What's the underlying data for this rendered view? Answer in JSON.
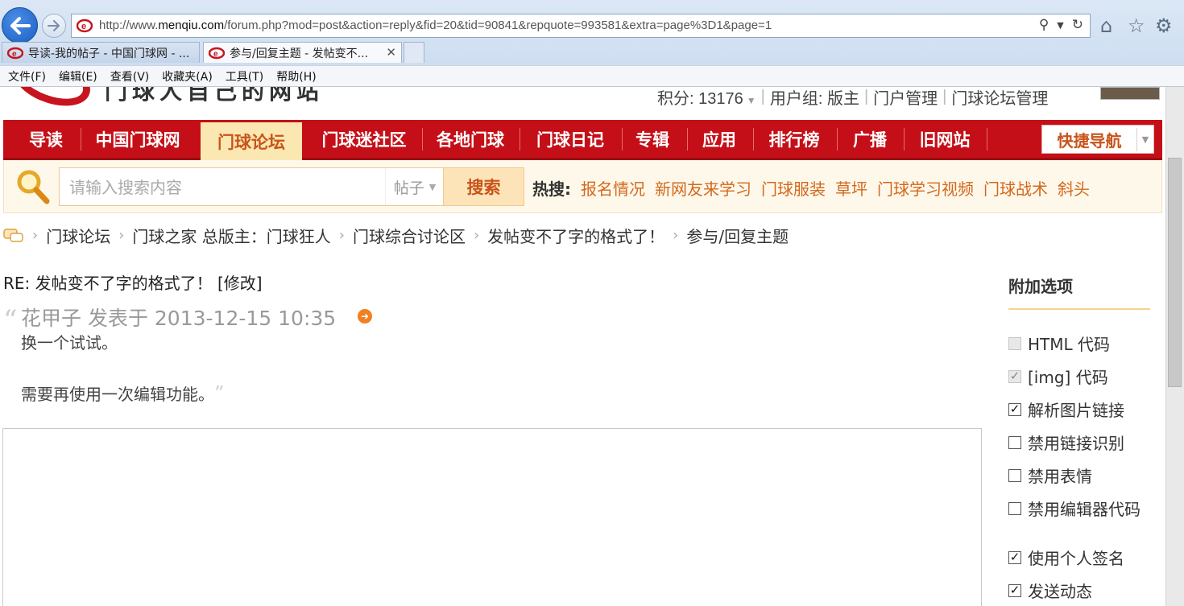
{
  "browser": {
    "url_prefix": "http://www.",
    "url_domain": "menqiu.com",
    "url_rest": "/forum.php?mod=post&action=reply&fid=20&tid=90841&repquote=993581&extra=page%3D1&page=1",
    "tabs": [
      {
        "label": "导读-我的帖子 - 中国门球网 - ...",
        "active": false
      },
      {
        "label": "参与/回复主题 - 发帖变不...",
        "active": true
      }
    ],
    "menu": [
      "文件(F)",
      "编辑(E)",
      "查看(V)",
      "收藏夹(A)",
      "工具(T)",
      "帮助(H)"
    ]
  },
  "header": {
    "logo_text": "门球人自己的网站",
    "points_label": "积分: 13176",
    "user_group": "用户组: 版主",
    "portal_admin": "门户管理",
    "forum_admin": "门球论坛管理"
  },
  "nav": {
    "items": [
      "导读",
      "中国门球网",
      "门球论坛",
      "门球迷社区",
      "各地门球",
      "门球日记",
      "专辑",
      "应用",
      "排行榜",
      "广播",
      "旧网站"
    ],
    "active_index": 2,
    "quick_nav": "快捷导航"
  },
  "search": {
    "placeholder": "请输入搜索内容",
    "type": "帖子",
    "button": "搜索",
    "hot_label": "热搜:",
    "hot_terms": [
      "报名情况",
      "新网友来学习",
      "门球服装",
      "草坪",
      "门球学习视频",
      "门球战术",
      "斜头"
    ]
  },
  "breadcrumb": [
    "门球论坛",
    "门球之家 总版主：门球狂人",
    "门球综合讨论区",
    "发帖变不了字的格式了！",
    "参与/回复主题"
  ],
  "post": {
    "title": "RE: 发帖变不了字的格式了！ [修改]",
    "quote_author": "花甲子 发表于 2013-12-15 10:35",
    "quote_line1": "换一个试试。",
    "quote_line2": "需要再使用一次编辑功能。"
  },
  "options": {
    "title": "附加选项",
    "items": [
      {
        "label": "HTML 代码",
        "checked": false,
        "disabled": true
      },
      {
        "label": "[img] 代码",
        "checked": true,
        "disabled": true
      },
      {
        "label": "解析图片链接",
        "checked": true,
        "disabled": false
      },
      {
        "label": "禁用链接识别",
        "checked": false,
        "disabled": false
      },
      {
        "label": "禁用表情",
        "checked": false,
        "disabled": false
      },
      {
        "label": "禁用编辑器代码",
        "checked": false,
        "disabled": false
      },
      {
        "label": "使用个人签名",
        "checked": true,
        "disabled": false
      },
      {
        "label": "发送动态",
        "checked": true,
        "disabled": false
      }
    ]
  },
  "colors": {
    "nav_red": "#c50f18",
    "accent_orange": "#d2681d",
    "active_tab_bg": "#fbe7b2"
  }
}
